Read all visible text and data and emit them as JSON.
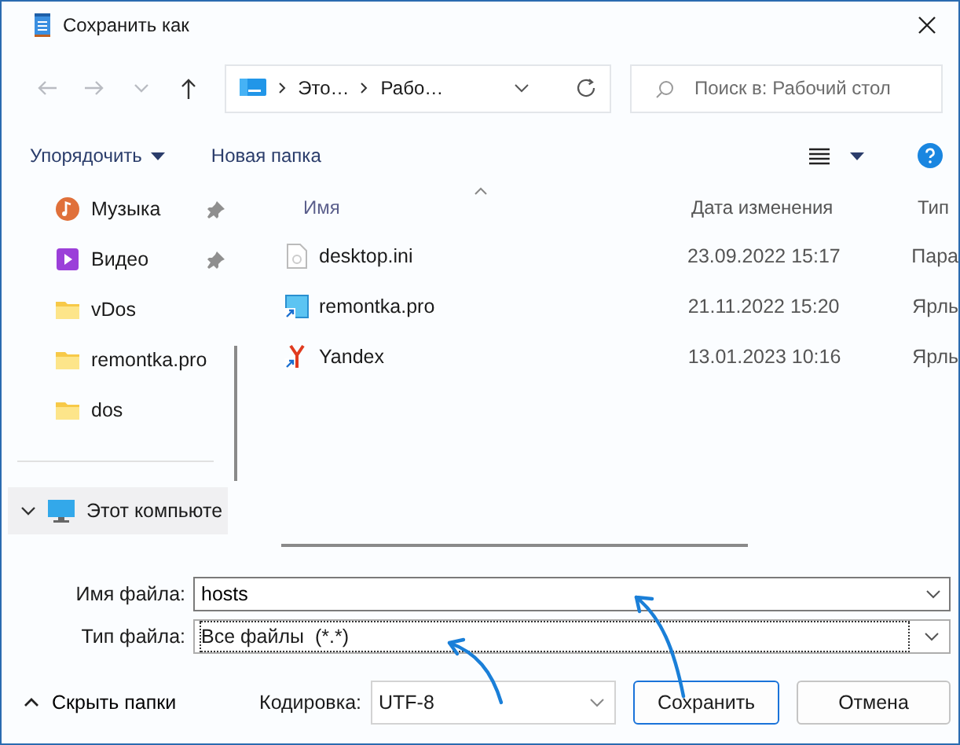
{
  "window": {
    "title": "Сохранить как"
  },
  "nav_buttons": [
    {
      "kind": "back",
      "disabled": true
    },
    {
      "kind": "forward",
      "disabled": true
    },
    {
      "kind": "recent",
      "disabled": true
    },
    {
      "kind": "up",
      "disabled": false
    }
  ],
  "address": {
    "segments": [
      "Это…",
      "Рабо…"
    ]
  },
  "search": {
    "placeholder": "Поиск в: Рабочий стол"
  },
  "toolbar": {
    "organize": "Упорядочить",
    "new_folder": "Новая папка"
  },
  "sidebar": {
    "items": [
      {
        "label": "Музыка",
        "kind": "music",
        "pinned": true,
        "selected": false
      },
      {
        "label": "Видео",
        "kind": "video",
        "pinned": true,
        "selected": false
      },
      {
        "label": "vDos",
        "kind": "folder",
        "pinned": false,
        "selected": false
      },
      {
        "label": "remontka.pro",
        "kind": "folder",
        "pinned": false,
        "selected": false
      },
      {
        "label": "dos",
        "kind": "folder",
        "pinned": false,
        "selected": false
      },
      {
        "label": "Этот компьюте",
        "kind": "computer",
        "pinned": false,
        "selected": true,
        "expanded": true
      }
    ]
  },
  "files": {
    "columns": [
      "Имя",
      "Дата изменения",
      "Тип"
    ],
    "rows": [
      {
        "name": "desktop.ini",
        "kind": "ini",
        "modified": "23.09.2022 15:17",
        "type": "Пара"
      },
      {
        "name": "remontka.pro",
        "kind": "shortcut",
        "modified": "21.11.2022 15:20",
        "type": "Ярль"
      },
      {
        "name": "Yandex",
        "kind": "yandex",
        "modified": "13.01.2023 10:16",
        "type": "Ярль"
      }
    ]
  },
  "form": {
    "filename_label": "Имя файла:",
    "filename": "hosts",
    "filetype_label": "Тип файла:",
    "filetype": "Все файлы  (*.*)",
    "hide_folders": "Скрыть папки",
    "encoding_label": "Кодировка:",
    "encoding": "UTF-8",
    "buttons": [
      {
        "label": "Сохранить",
        "default": true
      },
      {
        "label": "Отмена",
        "default": false
      }
    ]
  }
}
